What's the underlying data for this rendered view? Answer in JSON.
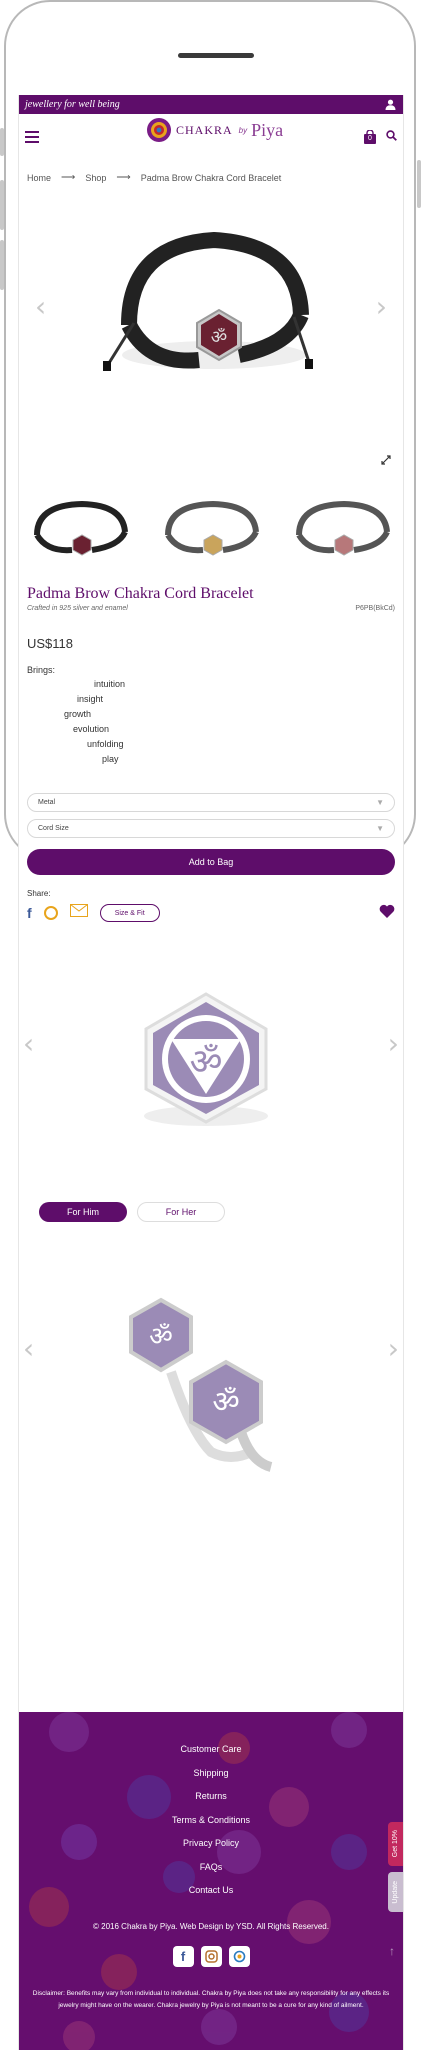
{
  "topbar": {
    "tagline": "jewellery for well being"
  },
  "logo": {
    "brand": "CHAKRA",
    "by": "by",
    "piya": "Piya"
  },
  "cart": {
    "count": "0"
  },
  "breadcrumb": {
    "home": "Home",
    "shop": "Shop",
    "current": "Padma Brow Chakra Cord Bracelet",
    "separator": "⟶"
  },
  "product": {
    "title": "Padma Brow Chakra Cord Bracelet",
    "subtitle": "Crafted in 925 silver and enamel",
    "sku": "P6PB(BkCd)",
    "price": "US$118",
    "brings_label": "Brings:",
    "brings": [
      "intuition",
      "insight",
      "growth",
      "evolution",
      "unfolding",
      "play"
    ]
  },
  "options": {
    "metal": "Metal",
    "cord_size": "Cord Size"
  },
  "actions": {
    "add_to_bag": "Add to Bag",
    "share_label": "Share:",
    "size_fit": "Size & Fit"
  },
  "toggle": {
    "him": "For Him",
    "her": "For Her"
  },
  "footer": {
    "links": [
      "Customer Care",
      "Shipping",
      "Returns",
      "Terms & Conditions",
      "Privacy Policy",
      "FAQs",
      "Contact Us"
    ],
    "copyright": "© 2016 Chakra by Piya. Web Design by YSD. All Rights Reserved.",
    "disclaimer": "Disclaimer: Benefits may vary from individual to individual. Chakra by Piya does not take any responsibility for any effects its jewelry might have on the wearer. Chakra jewelry by Piya is not meant to be a cure for any kind of ailment.",
    "side_get": "Get 10%",
    "side_update": "Update"
  },
  "colors": {
    "brand": "#5e0d6a",
    "footer": "#650e6e",
    "symbol": "#9b8bb6"
  }
}
